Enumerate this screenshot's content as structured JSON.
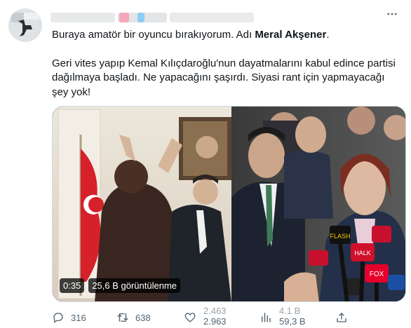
{
  "tweet": {
    "text_part1": "Buraya amatör bir oyuncu bırakıyorum. Adı ",
    "text_bold": "Meral Akşener",
    "text_part2": ".",
    "paragraph2": "Geri vites yapıp Kemal Kılıçdaroğlu'nun dayatmalarını kabul edince partisi dağılmaya başladı. Ne yapacağını şaşırdı. Siyasi rant için yapmayacağı şey yok!"
  },
  "media": {
    "duration": "0:35",
    "views": "25,6 B görüntülenme"
  },
  "actions": {
    "reply_count": "316",
    "retweet_count": "638",
    "like_count_top": "2.463",
    "like_count": "2.963",
    "views_count_top": "4.1 B",
    "views_count": "59,3 B"
  },
  "icons": {
    "more": "more-icon",
    "reply": "reply-icon",
    "retweet": "retweet-icon",
    "like": "heart-icon",
    "views": "views-icon",
    "share": "share-icon"
  },
  "colors": {
    "text": "#0f1419",
    "muted": "#536471",
    "border": "#cfd9de",
    "blur_red": "#f4a7b9",
    "blur_blue": "#8ecdf7"
  }
}
